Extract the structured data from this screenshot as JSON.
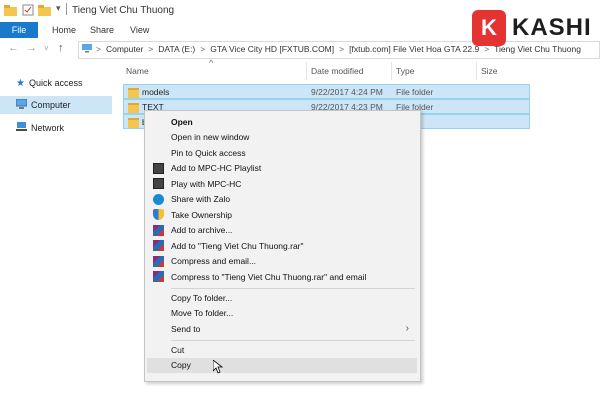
{
  "window": {
    "title": "Tieng Viet Chu Thuong"
  },
  "ribbon": {
    "file": "File",
    "tabs": [
      "Home",
      "Share",
      "View"
    ]
  },
  "address": {
    "crumbs": [
      "Computer",
      "DATA (E:)",
      "GTA Vice City HD [FXTUB.COM]",
      "[fxtub.com] File Viet Hoa GTA 22.9",
      "Tieng Viet Chu Thuong"
    ],
    "separator": ">"
  },
  "logo": {
    "letter": "K",
    "text": "KASHI",
    "color": "#e53333"
  },
  "nav_pane": {
    "items": [
      {
        "label": "Quick access",
        "icon": "star-icon"
      },
      {
        "label": "Computer",
        "icon": "computer-icon",
        "selected": true
      },
      {
        "label": "Network",
        "icon": "network-icon"
      }
    ]
  },
  "columns": {
    "name": "Name",
    "date": "Date modified",
    "type": "Type",
    "size": "Size"
  },
  "files": [
    {
      "name": "models",
      "date": "9/22/2017 4:24 PM",
      "type": "File folder"
    },
    {
      "name": "TEXT",
      "date": "9/22/2017 4:23 PM",
      "type": "File folder"
    },
    {
      "name": "b",
      "date": "",
      "type": "older"
    }
  ],
  "context_menu": {
    "items": [
      {
        "label": "Open",
        "bold": true
      },
      {
        "label": "Open in new window"
      },
      {
        "label": "Pin to Quick access"
      },
      {
        "label": "Add to MPC-HC Playlist",
        "icon": "mpc-icon"
      },
      {
        "label": "Play with MPC-HC",
        "icon": "mpc-icon"
      },
      {
        "label": "Share with Zalo",
        "icon": "zalo-icon"
      },
      {
        "label": "Take Ownership",
        "icon": "shield-icon"
      },
      {
        "label": "Add to archive...",
        "icon": "winrar-icon"
      },
      {
        "label": "Add to \"Tieng Viet Chu Thuong.rar\"",
        "icon": "winrar-icon"
      },
      {
        "label": "Compress and email...",
        "icon": "winrar-icon"
      },
      {
        "label": "Compress to \"Tieng Viet Chu Thuong.rar\" and email",
        "icon": "winrar-icon"
      },
      {
        "label": "Copy To folder..."
      },
      {
        "label": "Move To folder..."
      },
      {
        "label": "Send to",
        "submenu": true
      },
      {
        "label": "Cut"
      },
      {
        "label": "Copy",
        "hover": true
      }
    ]
  },
  "colors": {
    "file_tab": "#1979ca",
    "selection": "#cce6f8",
    "folder": "#f3c64f"
  }
}
